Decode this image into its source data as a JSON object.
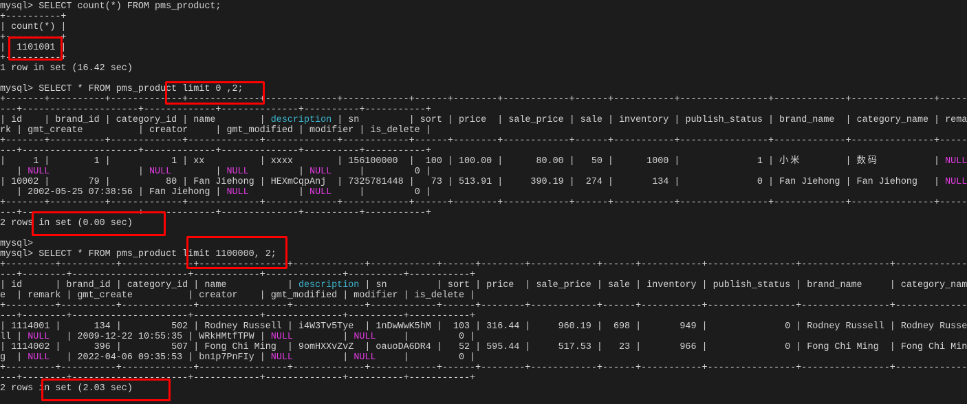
{
  "colors": {
    "background": "#1c1c1c",
    "text": "#d4d4d4",
    "null": "#e23ce2",
    "column_highlight": "#3cb4cc",
    "highlight_box": "#ff0000"
  },
  "highlight_tokens": {
    "null": "NULL",
    "column": "description"
  },
  "terminal": {
    "lines": [
      "mysql> SELECT count(*) FROM pms_product;",
      "+----------+",
      "| count(*) |",
      "+----------+",
      "|  1101001 |",
      "+----------+",
      "1 row in set (16.42 sec)",
      "",
      "mysql> SELECT * FROM pms_product limit 0 ,2;",
      "+-------+----------+-------------+-------------+-------------+------------+------+--------+------------+------+-----------+----------------+-------------+---------------+-----",
      "---+---------------------+-------------+--------------+----------+-----------+",
      "| id    | brand_id | category_id | name        | description | sn         | sort | price  | sale_price | sale | inventory | publish_status | brand_name  | category_name | rema",
      "rk | gmt_create          | creator     | gmt_modified | modifier | is_delete |",
      "+-------+----------+-------------+-------------+-------------+------------+------+--------+------------+------+-----------+----------------+-------------+---------------+-----",
      "---+---------------------+-------------+--------------+----------+-----------+",
      "|     1 |        1 |           1 | xx          | xxxx        | 156100000  |  100 | 100.00 |      80.00 |   50 |      1000 |              1 | 小米        | 数码          | NULL",
      "   | NULL                | NULL        | NULL         | NULL     |         0 |",
      "| 10002 |       79 |          80 | Fan Jiehong | HEXmCqpAnj  | 7325781448 |   73 | 513.91 |     390.19 |  274 |       134 |              0 | Fan Jiehong | Fan Jiehong   | NULL",
      "   | 2002-05-25 07:38:56 | Fan Jiehong | NULL         | NULL     |         0 |",
      "+-------+----------+-------------+-------------+-------------+------------+------+--------+------------+------+-----------+----------------+-------------+---------------+-----",
      "---+---------------------+-------------+--------------+----------+-----------+",
      "2 rows in set (0.00 sec)",
      "",
      "mysql>",
      "mysql> SELECT * FROM pms_product limit 1100000, 2;",
      "+---------+----------+-------------+----------------+-------------+------------+------+--------+------------+------+-----------+----------------+----------------+-------------",
      "---+--------+---------------------+------------+--------------+----------+-----------+",
      "| id      | brand_id | category_id | name           | description | sn         | sort | price  | sale_price | sale | inventory | publish_status | brand_name     | category_nam",
      "e  | remark | gmt_create          | creator    | gmt_modified | modifier | is_delete |",
      "+---------+----------+-------------+----------------+-------------+------------+------+--------+------------+------+-----------+----------------+----------------+-------------",
      "---+--------+---------------------+------------+--------------+----------+-----------+",
      "| 1114001 |      134 |         502 | Rodney Russell | i4W3Tv5Tye  | 1nDwWwK5hM |  103 | 316.44 |     960.19 |  698 |       949 |              0 | Rodney Russell | Rodney Russe",
      "ll | NULL   | 2009-12-22 10:55:35 | WRkHMtfTPW | NULL         | NULL     |         0 |",
      "| 1114002 |      396 |         507 | Fong Chi Ming  | 9omHXXvZvZ  | oauoDA6DR4 |   52 | 595.44 |     517.53 |   23 |       966 |              0 | Fong Chi Ming  | Fong Chi Min",
      "g  | NULL   | 2022-04-06 09:35:53 | bn1p7PnFIy | NULL         | NULL     |         0 |",
      "+---------+----------+-------------+----------------+-------------+------------+------+--------+------------+------+-----------+----------------+----------------+-------------",
      "---+--------+---------------------+------------+--------------+----------+-----------+",
      "2 rows in set (2.03 sec)",
      ""
    ]
  }
}
